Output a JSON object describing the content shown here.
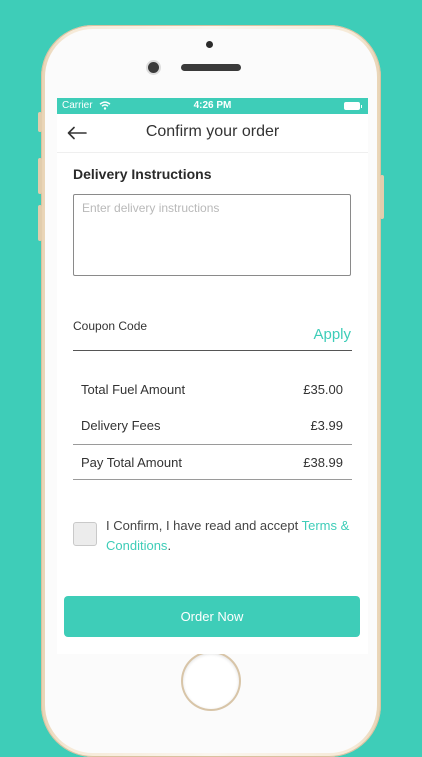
{
  "status_bar": {
    "carrier": "Carrier",
    "time": "4:26 PM"
  },
  "header": {
    "title": "Confirm your order"
  },
  "delivery": {
    "label": "Delivery Instructions",
    "placeholder": "Enter delivery instructions"
  },
  "coupon": {
    "label": "Coupon Code",
    "apply_label": "Apply"
  },
  "summary": {
    "rows": [
      {
        "label": "Total Fuel Amount",
        "value": "£35.00"
      },
      {
        "label": "Delivery Fees",
        "value": "£3.99"
      }
    ],
    "total": {
      "label": "Pay Total Amount",
      "value": "£38.99"
    }
  },
  "confirm": {
    "text": "I Confirm, I have read and accept ",
    "link": "Terms & Conditions",
    "suffix": ".",
    "checked": false
  },
  "order_button": {
    "label": "Order Now"
  },
  "colors": {
    "accent": "#3ecdb8",
    "background": "#3ecdb8",
    "text": "#333333"
  }
}
